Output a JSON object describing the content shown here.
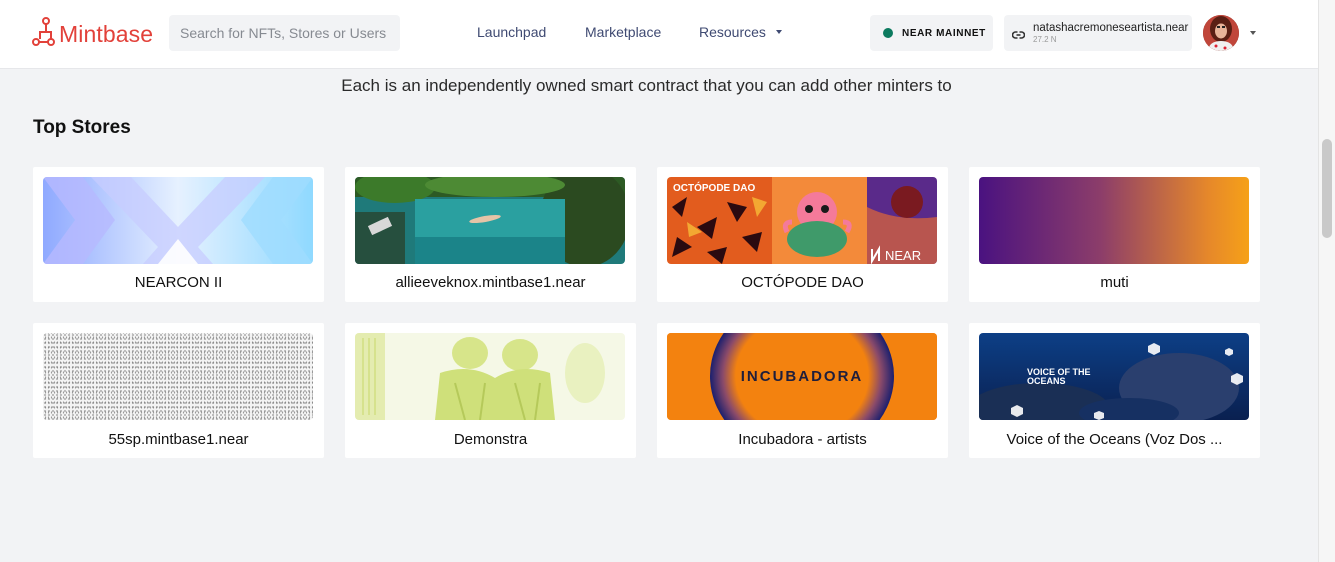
{
  "header": {
    "logo_text": "Mintbase",
    "search_placeholder": "Search for NFTs, Stores or Users",
    "nav": {
      "launchpad": "Launchpad",
      "marketplace": "Marketplace",
      "resources": "Resources"
    },
    "network_label": "NEAR MAINNET",
    "account_name": "natashacremoneseartista.near",
    "account_balance": "27.2 N"
  },
  "main": {
    "subtitle": "Each is an independently owned smart contract that you can add other minters to",
    "section_title": "Top Stores",
    "stores": [
      {
        "name": "NEARCON II"
      },
      {
        "name": "allieeveknox.mintbase1.near"
      },
      {
        "name": "OCTÓPODE DAO",
        "banner_text": "OCTÓPODE DAO",
        "banner_brand": "NEAR"
      },
      {
        "name": "muti"
      },
      {
        "name": "55sp.mintbase1.near"
      },
      {
        "name": "Demonstra"
      },
      {
        "name": "Incubadora - artists",
        "banner_text": "INCUBADORA"
      },
      {
        "name": "Voice of the Oceans (Voz Dos ...",
        "banner_text_line1": "VOICE OF THE",
        "banner_text_line2": "OCEANS"
      }
    ]
  },
  "colors": {
    "brand": "#e2413a",
    "nav_text": "#3f4a72",
    "network_dot": "#0c7a5f",
    "page_bg": "#f2f3f5"
  },
  "icons": [
    "mintbase-logo-icon",
    "link-icon",
    "chevron-down-icon",
    "avatar-image"
  ]
}
